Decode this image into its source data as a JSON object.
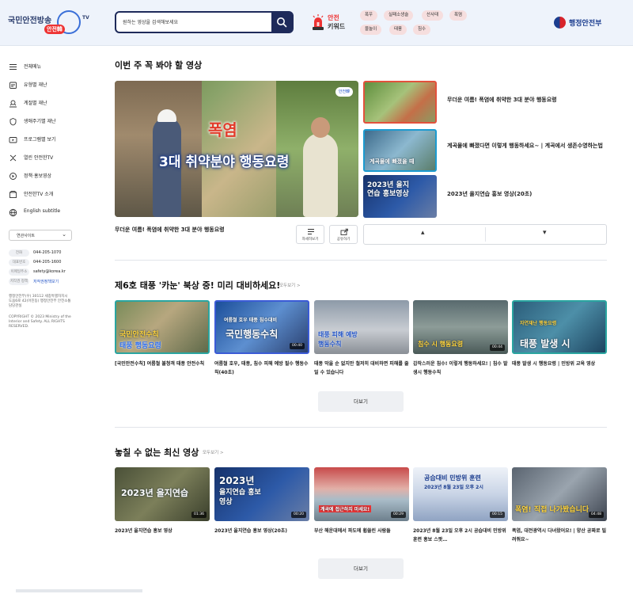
{
  "header": {
    "logo_text": "국민안전방송",
    "logo_badge": "안전韓",
    "logo_tv": "TV",
    "search_placeholder": "원하는 영상을 검색해보세요",
    "keyword_label_top": "안전",
    "keyword_label_bottom": "키워드",
    "keywords": [
      "폭우",
      "실패소생술",
      "산사태",
      "폭염",
      "물놀이",
      "태풍",
      "침수"
    ],
    "ministry": "행정안전부"
  },
  "sidebar": {
    "items": [
      {
        "label": "전체메뉴",
        "icon": "hamburger-icon"
      },
      {
        "label": "유형별 재난",
        "icon": "disaster-type-icon"
      },
      {
        "label": "계절별 재난",
        "icon": "season-icon"
      },
      {
        "label": "생애주기별 재난",
        "icon": "lifecycle-icon"
      },
      {
        "label": "프로그램별 보기",
        "icon": "program-icon"
      },
      {
        "label": "열린 안전한TV",
        "icon": "open-tv-icon"
      },
      {
        "label": "정책·홍보영상",
        "icon": "policy-icon"
      },
      {
        "label": "안전한TV 소개",
        "icon": "intro-icon"
      },
      {
        "label": "English subtitle",
        "icon": "globe-icon"
      }
    ],
    "site_select": "연관사이트",
    "contacts": [
      {
        "badge": "전화",
        "value": "044-205-1070",
        "link": false
      },
      {
        "badge": "대표번호",
        "value": "044-205-1600",
        "link": false
      },
      {
        "badge": "이메일주소",
        "value": "safety@korea.kr",
        "link": false
      },
      {
        "badge": "저작권 정책",
        "value": "저작권정책보기",
        "link": true
      }
    ],
    "address": "행정안전부(우) 30112 세종특별자치시 도움6로 42(어진동) 행정안전부 안전소통담당관실",
    "copyright": "COPYRIGHT © 2023 Ministry of the Interior and Safety. ALL RIGHTS RESERVED."
  },
  "weekly": {
    "title": "이번 주 꼭 봐야 할 영상",
    "feature": {
      "keyword": "폭염",
      "headline": "3대 취약분야 행동요령",
      "badge": "안전韓",
      "caption": "무더운 여름! 폭염에 취약한 3대 분야 행동요령"
    },
    "actions": [
      {
        "label": "자세히보기",
        "icon": "list-icon"
      },
      {
        "label": "공유하기",
        "icon": "share-icon"
      }
    ],
    "side_items": [
      {
        "title": "무더운 여름! 폭염에 취약한 3대 분야 행동요령"
      },
      {
        "title": "계곡물에 빠졌다면 이렇게 행동하세요~ | 계곡에서 생존수영하는법",
        "thumb_text": "계곡물에 빠졌을 때"
      },
      {
        "title": "2023년 을지연습 홍보 영상(20초)",
        "thumb_text": "2023년 을지연습 홍보영상"
      }
    ],
    "nav_up": "▴",
    "nav_down": "▾"
  },
  "typhoon": {
    "title": "제6호 태풍 '카눈' 북상 중! 미리 대비하세요!",
    "more": "모두보기 >",
    "cards": [
      {
        "title": "[국민안전수칙] 여름철 불청객 태풍 안전수칙",
        "thumb_top": "국민안전수칙",
        "thumb_bottom": "태풍 행동요령",
        "duration": ""
      },
      {
        "title": "여름철 호우, 태풍, 침수 피해 예방 필수 행동수칙(40초)",
        "thumb_top": "여름철 호우 태풍 침수대비",
        "thumb_bottom": "국민행동수칙",
        "duration": "00:40"
      },
      {
        "title": "태풍 막을 순 없지만 철저히 대비하면 피해를 줄일 수 있습니다",
        "thumb_top": "태풍 피해 예방",
        "thumb_bottom": "행동수칙",
        "duration": ""
      },
      {
        "title": "갑작스러운 침수! 이렇게 행동하세요! | 침수 발생시 행동수칙",
        "thumb_top": "",
        "thumb_bottom": "침수 시 행동요령",
        "duration": "00:44"
      },
      {
        "title": "태풍 발생 시 행동요령 | 민방위 교육 영상",
        "thumb_top": "자연재난 행동요령",
        "thumb_bottom": "태풍 발생 시",
        "duration": ""
      }
    ],
    "more_button": "더보기"
  },
  "latest": {
    "title": "놓칠 수 없는 최신 영상",
    "more": "모두보기 >",
    "cards": [
      {
        "title": "2023년 을지연습 홍보 영상",
        "thumb_top": "2023년 을지연습",
        "thumb_bottom": "",
        "duration": "01:36"
      },
      {
        "title": "2023년 을지연습 홍보 영상(20초)",
        "thumb_top": "2023년",
        "thumb_bottom": "을지연습 홍보영상",
        "duration": "00:20"
      },
      {
        "title": "부산 해운대에서 파도에 휩쓸린 사람들",
        "thumb_top": "",
        "thumb_bottom": "계곡에 접근하지 마세요!",
        "duration": "00:29"
      },
      {
        "title": "2023년 8월 23일 오후 2시 공습대비 민방위 훈련 홍보 스팟…",
        "thumb_top": "공습대비 민방위 훈련",
        "thumb_bottom": "2023년 8월 23일 오후 2시",
        "duration": "00:15"
      },
      {
        "title": "폭염, 대전광역시 다녀왔어요! | 양산 공짜로 빌려줘요~",
        "thumb_top": "",
        "thumb_bottom": "폭염! 직접 나가봤습니다",
        "duration": "04:48"
      }
    ],
    "more_button": "더보기"
  },
  "colors": {
    "navy": "#1e2a5a",
    "keyword_chip": "#f6dede",
    "accent_red": "#e33333",
    "link_blue": "#2455c7"
  }
}
